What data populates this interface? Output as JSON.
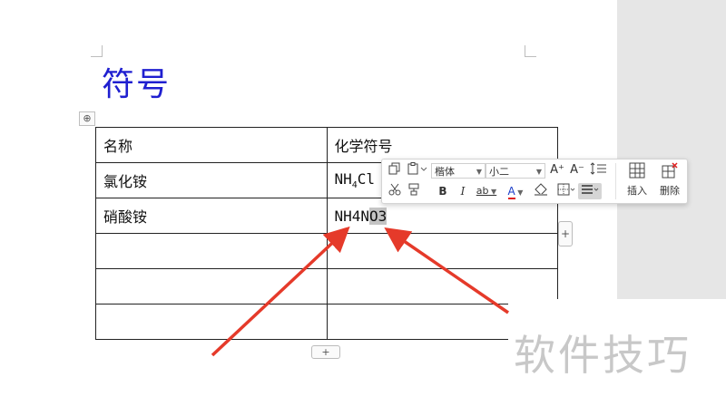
{
  "document": {
    "title": "符号",
    "table": {
      "rows": [
        [
          "名称",
          "化学符号"
        ],
        [
          "氯化铵",
          "NH4Cl"
        ],
        [
          "硝酸铵",
          "NH4NO3"
        ],
        [
          "",
          ""
        ],
        [
          "",
          ""
        ],
        [
          "",
          ""
        ]
      ],
      "nh4cl": {
        "base": "NH",
        "sub": "4",
        "rest": "Cl"
      },
      "nh4no3": {
        "pre": "NH4N",
        "sel1": "O",
        "mid": "",
        "sel2": "3"
      }
    },
    "add_column_label": "+",
    "add_row_label": "+",
    "move_handle_label": "⊕"
  },
  "toolbar": {
    "font_name": "楷体",
    "font_size": "小二",
    "grow_font": "A⁺",
    "shrink_font": "A⁻",
    "bold": "B",
    "italic": "I",
    "underline": "ab",
    "font_color": "A",
    "insert_label": "插入",
    "delete_label": "删除",
    "icons": [
      "copy-icon",
      "paste-icon",
      "cut-icon",
      "format-painter-icon",
      "line-spacing-icon",
      "highlight-icon",
      "shading-icon",
      "border-icon",
      "align-icon",
      "insert-table-icon",
      "delete-table-icon"
    ]
  },
  "watermark": "软件技巧",
  "colors": {
    "title": "#1f1fd0",
    "arrow": "#e53a2a"
  }
}
